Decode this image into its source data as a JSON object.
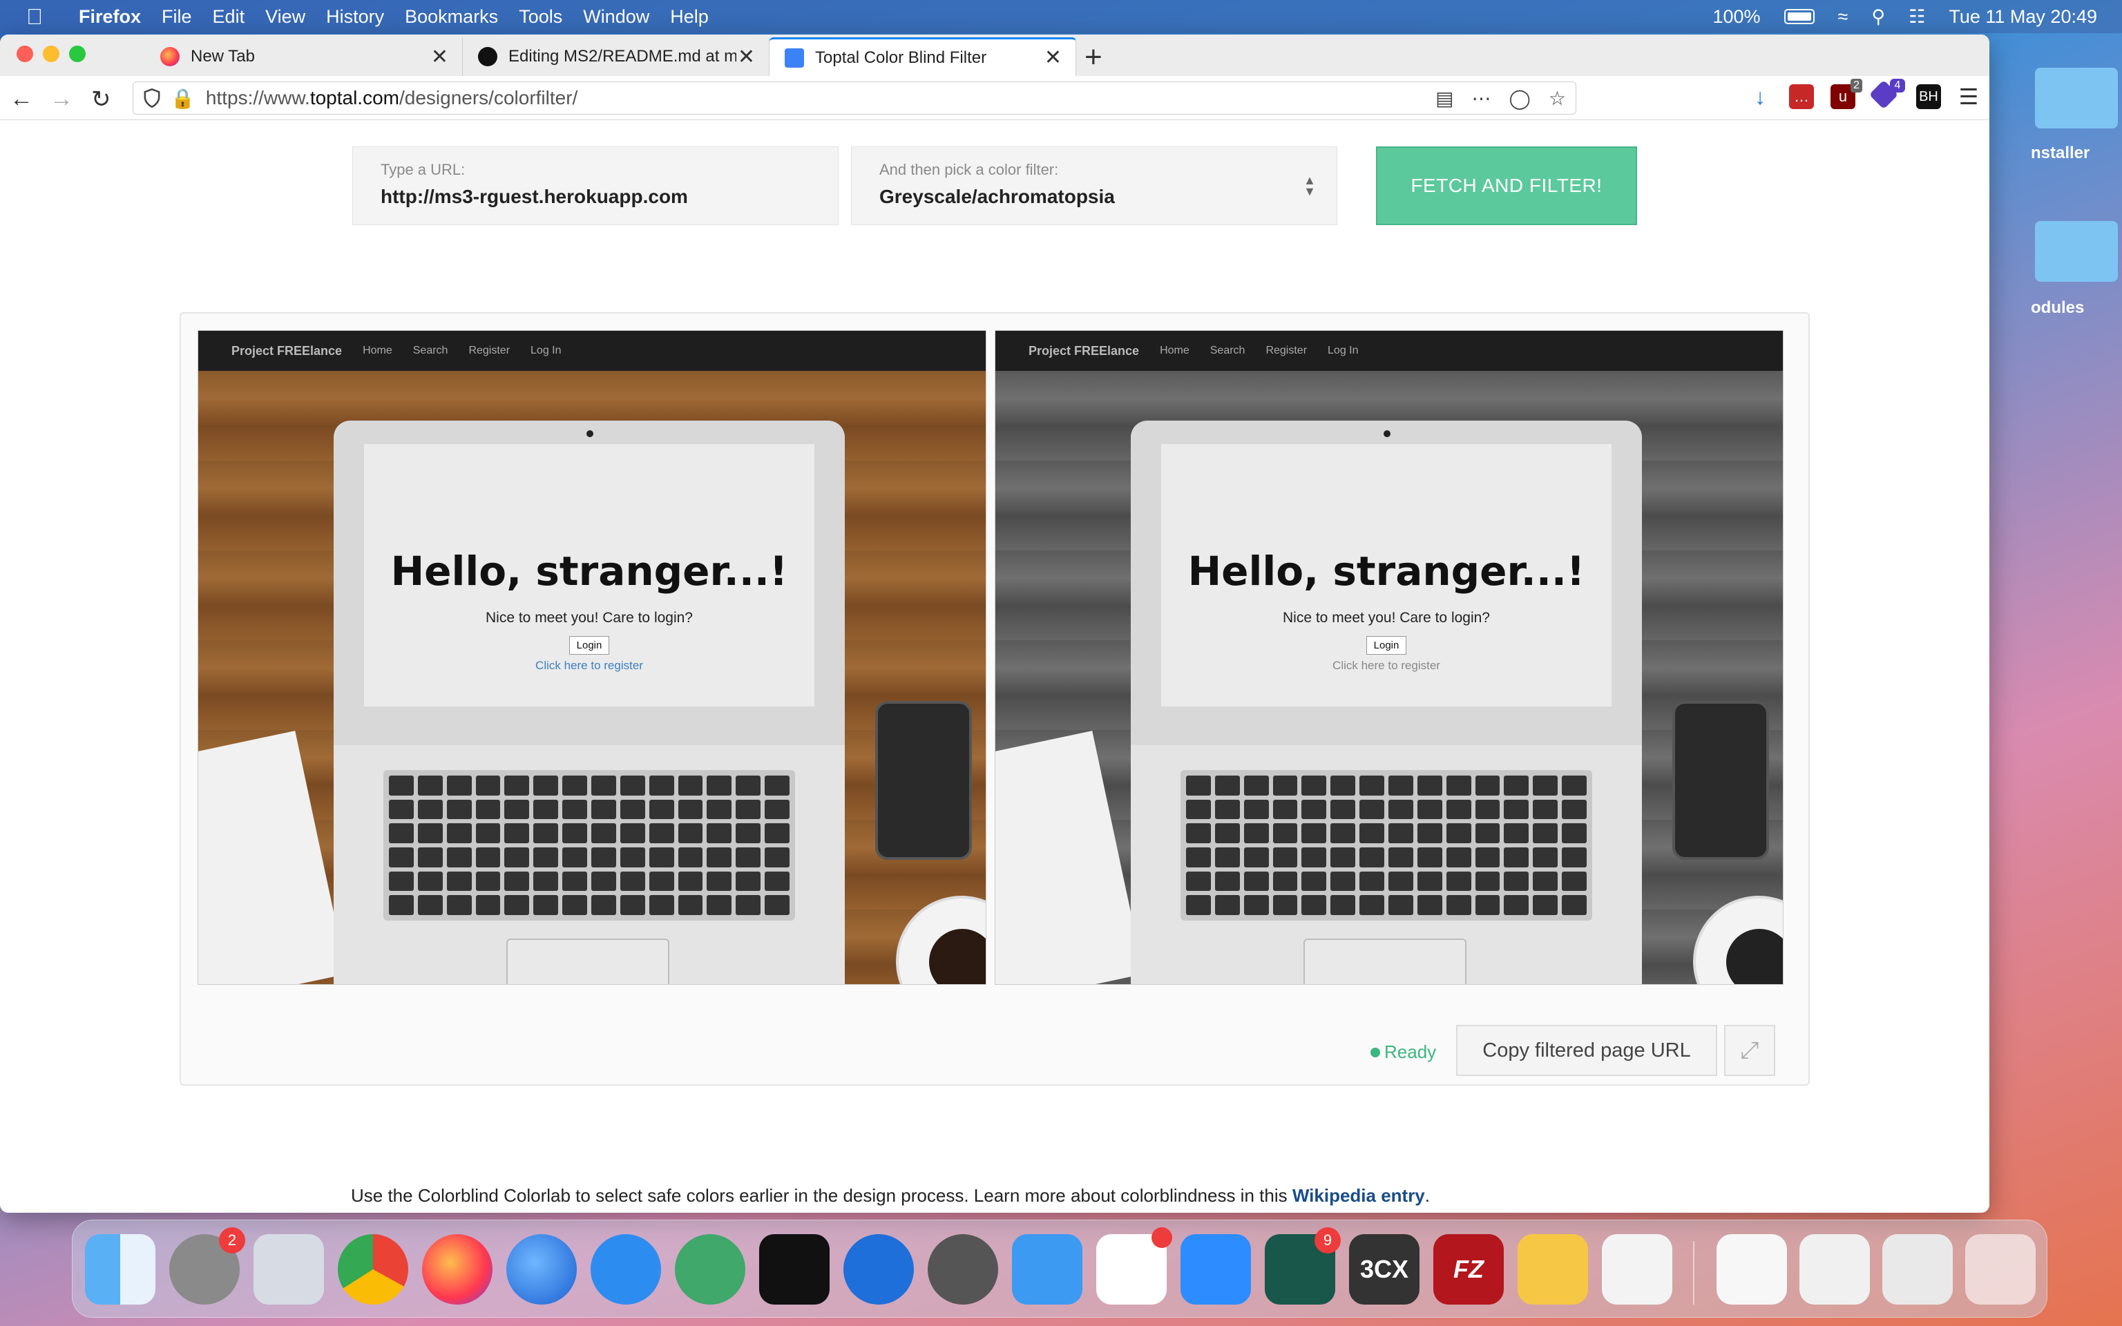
{
  "menubar": {
    "app_name": "Firefox",
    "items": [
      "File",
      "Edit",
      "View",
      "History",
      "Bookmarks",
      "Tools",
      "Window",
      "Help"
    ],
    "battery": "100%",
    "clock": "Tue 11 May  20:49"
  },
  "tabs": [
    {
      "label": "New Tab",
      "icon": "firefox-icon"
    },
    {
      "label": "Editing MS2/README.md at ma",
      "icon": "github-icon"
    },
    {
      "label": "Toptal Color Blind Filter",
      "icon": "toptal-icon"
    }
  ],
  "urlbar": {
    "prefix": "https://www.",
    "domain": "toptal.com",
    "path": "/designers/colorfilter/"
  },
  "extensions": {
    "ublock_badge": "2",
    "ext2_badge": "4",
    "bh_label": "BH"
  },
  "form": {
    "url_label": "Type a URL:",
    "url_value": "http://ms3-rguest.herokuapp.com",
    "filter_label": "And then pick a color filter:",
    "filter_value": "Greyscale/achromatopsia",
    "fetch_button": "FETCH AND FILTER!"
  },
  "preview": {
    "site_brand": "Project FREElance",
    "site_nav": [
      "Home",
      "Search",
      "Register",
      "Log In"
    ],
    "hello": "Hello, stranger...!",
    "subtitle": "Nice to meet you! Care to login?",
    "login_button": "Login",
    "register_link": "Click here to register"
  },
  "status": {
    "ready": "Ready",
    "copy_button": "Copy filtered page URL"
  },
  "footnote": {
    "text": "Use the Colorblind Colorlab to select safe colors earlier in the design process. Learn more about colorblindness in this ",
    "link": "Wikipedia entry",
    "end": "."
  },
  "desktop": {
    "label1": "nstaller",
    "label2": "odules"
  },
  "dock": {
    "system_prefs_badge": "2",
    "wunderlist_badge": "9",
    "threecx_label": "3CX",
    "filezilla_label": "FZ"
  },
  "colors": {
    "accent_green": "#5cc99c",
    "ready_green": "#3db57f",
    "link_blue": "#1a4d8a",
    "register_link_color": "#3b7fc4"
  }
}
